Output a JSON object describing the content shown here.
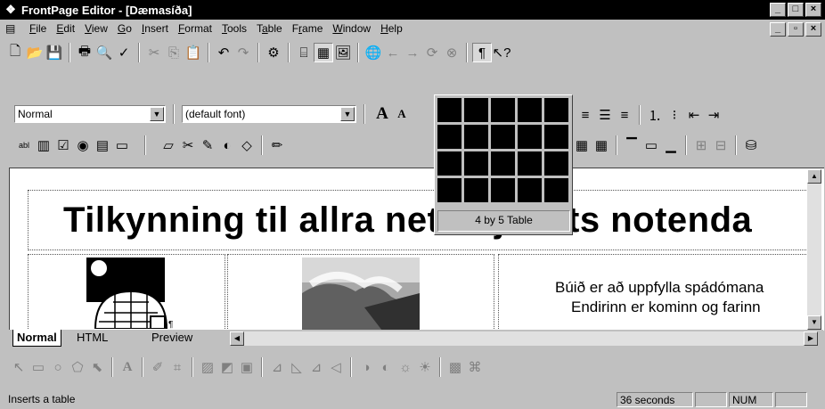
{
  "window": {
    "title": "FrontPage Editor - [Dæmasíða]",
    "controls": [
      "_",
      "□",
      "×"
    ],
    "doc_controls": [
      "_",
      "▫",
      "×"
    ]
  },
  "menu": [
    {
      "label": "File",
      "key": "F",
      "rest": "ile"
    },
    {
      "label": "Edit",
      "key": "E",
      "rest": "dit"
    },
    {
      "label": "View",
      "key": "V",
      "rest": "iew"
    },
    {
      "label": "Go",
      "key": "G",
      "rest": "o"
    },
    {
      "label": "Insert",
      "key": "I",
      "rest": "nsert"
    },
    {
      "label": "Format",
      "key": "F",
      "rest": "ormat",
      "pre": ""
    },
    {
      "label": "Tools",
      "key": "T",
      "rest": "ools"
    },
    {
      "label": "Table",
      "key": "a",
      "pre": "T",
      "rest": "ble"
    },
    {
      "label": "Frame",
      "key": "r",
      "pre": "F",
      "rest": "ame"
    },
    {
      "label": "Window",
      "key": "W",
      "rest": "indow"
    },
    {
      "label": "Help",
      "key": "H",
      "rest": "elp"
    }
  ],
  "format_bar": {
    "style_value": "Normal",
    "font_value": "(default font)",
    "increase_font": "A",
    "decrease_font": "A"
  },
  "document": {
    "heading": "Tilkynning til allra netverjanets notenda",
    "para1": "Búið er að uppfylla spádómana",
    "para2": "Endirinn er kominn og farinn"
  },
  "table_picker": {
    "rows": 4,
    "cols": 5,
    "label": "4 by 5 Table"
  },
  "view_tabs": [
    "Normal",
    "HTML",
    "Preview"
  ],
  "status": {
    "message": "Inserts a table",
    "time": "36 seconds",
    "num": "NUM"
  }
}
